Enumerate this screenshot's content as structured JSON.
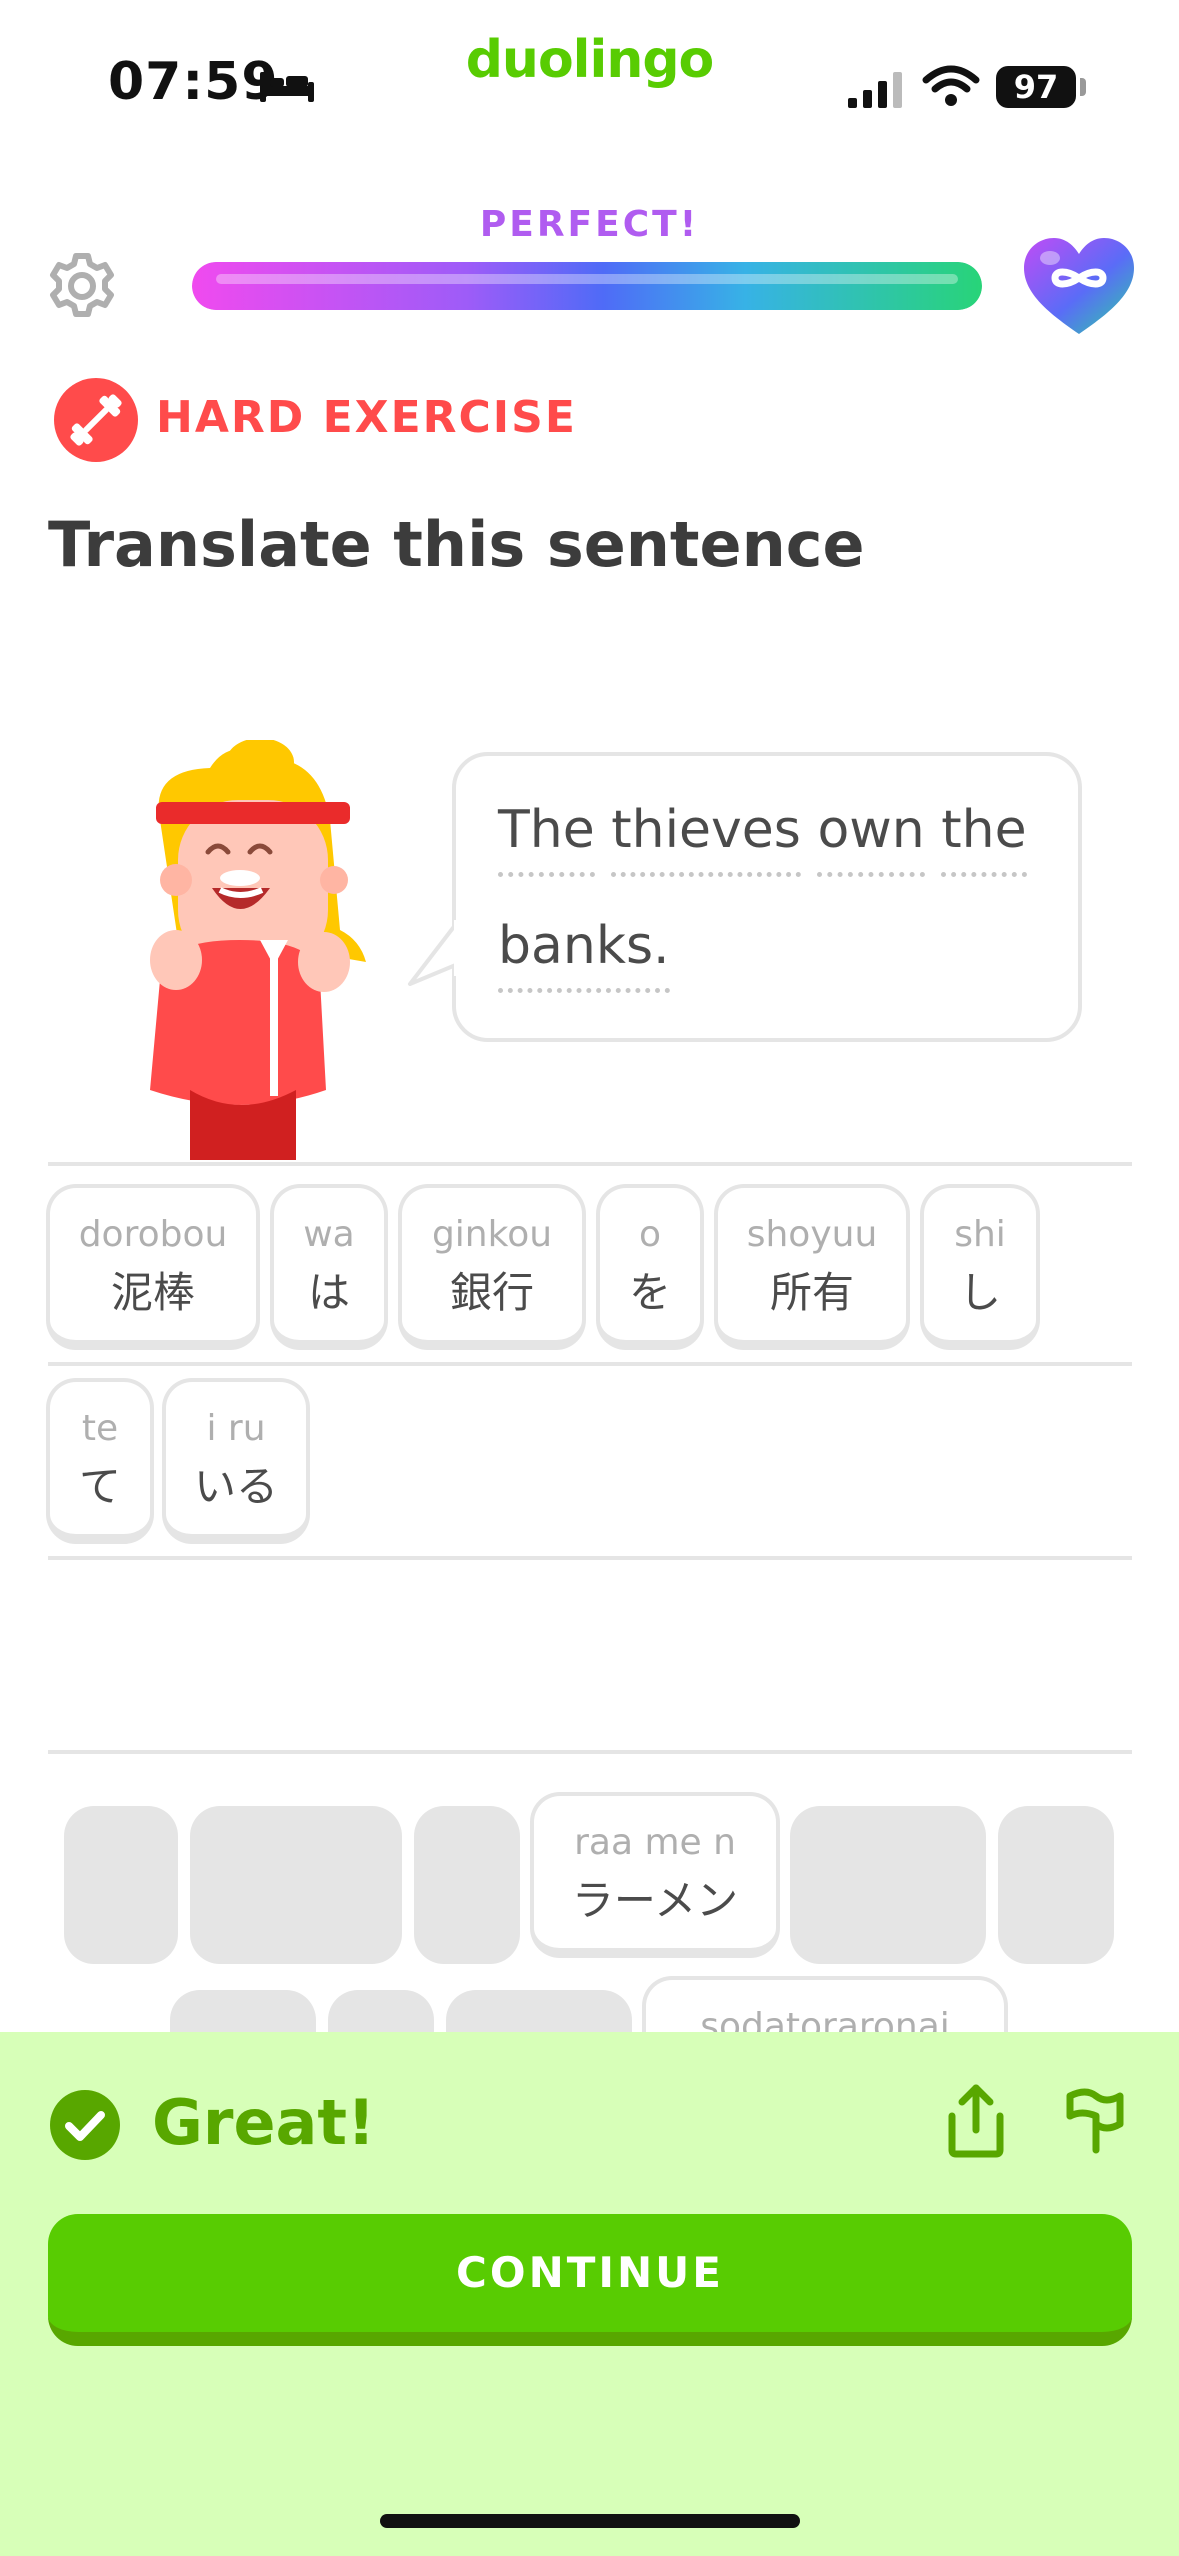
{
  "status_bar": {
    "time": "07:59",
    "battery": "97",
    "icons": [
      "bed-icon",
      "signal-icon",
      "wifi-icon",
      "battery-icon"
    ]
  },
  "brand": "duolingo",
  "lesson": {
    "streak_label": "PERFECT!",
    "progress": 1.0,
    "hearts": "infinite"
  },
  "exercise": {
    "badge": "HARD EXERCISE",
    "title": "Translate this sentence",
    "prompt_words": [
      "The",
      "thieves",
      "own",
      "the",
      "banks."
    ]
  },
  "answer_tiles": [
    {
      "romaji": "dorobou",
      "kana": "泥棒"
    },
    {
      "romaji": "wa",
      "kana": "は"
    },
    {
      "romaji": "ginkou",
      "kana": "銀行"
    },
    {
      "romaji": "o",
      "kana": "を"
    },
    {
      "romaji": "shoyuu",
      "kana": "所有"
    },
    {
      "romaji": "shi",
      "kana": "し"
    },
    {
      "romaji": "te",
      "kana": "て"
    },
    {
      "romaji": "i ru",
      "kana": "いる"
    }
  ],
  "word_bank": {
    "visible_tile": {
      "romaji": "raa me n",
      "kana": "ラーメン"
    },
    "partial_tile_romaji": "sodatoraronai"
  },
  "feedback": {
    "message": "Great!",
    "continue_label": "CONTINUE"
  },
  "colors": {
    "brand_green": "#58cc02",
    "dark_green": "#58a700",
    "feedback_bg": "#d7ffb8",
    "hard_red": "#ff4b4b"
  }
}
